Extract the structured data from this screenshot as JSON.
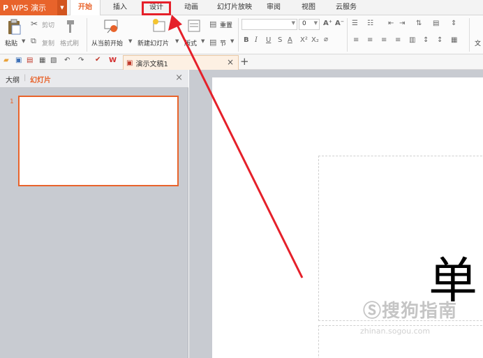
{
  "menubar": {
    "app_label": "WPS 演示",
    "tabs": [
      {
        "label": "开始",
        "active": true
      },
      {
        "label": "插入"
      },
      {
        "label": "设计"
      },
      {
        "label": "动画"
      },
      {
        "label": "幻灯片放映"
      },
      {
        "label": "审阅"
      },
      {
        "label": "视图"
      },
      {
        "label": "云服务"
      }
    ]
  },
  "ribbon": {
    "paste": "粘贴",
    "cut": "剪切",
    "copy": "复制",
    "format_painter": "格式刷",
    "from_current": "从当前开始",
    "new_slide": "新建幻灯片",
    "layout": "版式",
    "section": "节",
    "reset": "重置",
    "font_size": "0",
    "text_label": "文"
  },
  "quickbar": {
    "doc_tab_title": "演示文稿1"
  },
  "sidepanel": {
    "tab_outline": "大纲",
    "tab_slides": "幻灯片",
    "slide_number": "1"
  },
  "canvas": {
    "big_char": "单"
  },
  "watermark": {
    "text": "搜狗指南",
    "sub": "zhinan.sogou.com"
  },
  "colors": {
    "accent": "#e8632b",
    "annotation": "#e5202a",
    "panel_bg": "#c8cbd1"
  }
}
